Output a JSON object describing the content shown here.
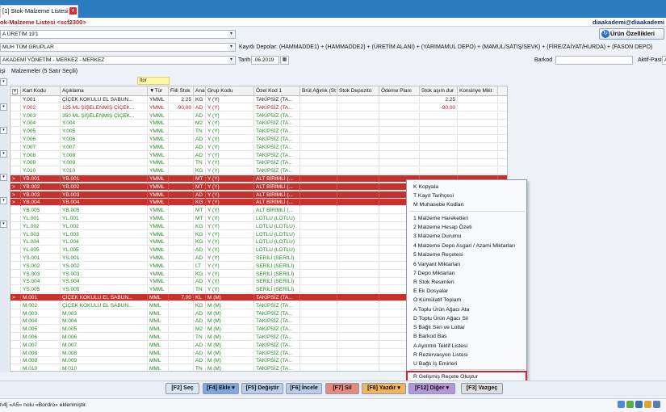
{
  "tab": {
    "label": "[1] Stok-Malzeme Listesi",
    "close": "x"
  },
  "window": {
    "title": "ok-Malzeme Listesi <scf2300>",
    "user": "diaakademi@diaakademi"
  },
  "filters": {
    "donem": "A ÜRETİM 19'1",
    "grup": "MUH TÜM GRUPLAR",
    "sube": "AKADEMİ YÖNETİM - MERKEZ - MERKEZ",
    "depolar_label": "Kayıtlı Depolar:",
    "depolar_value": "(HAMMADDE1) + (HAMMADDE2) + (ÜRETİM ALANI) + (YARIMAMUL DEPO) + (MAMUL/SATIŞ/SEVK) + (FİRE/ZAİYAT/HURDA) + (FASON DEPO)",
    "tarih_label": "Tarih",
    "tarih_value": ".06.2019",
    "barkod_label": "Barkod",
    "aktif_label": "Aktif-Pasif",
    "aktif_value": "A",
    "urun_btn": "Ürün Özellikleri"
  },
  "section": {
    "left_label": "işi",
    "title": "Malzemeler",
    "rowcount": "(5 Satır Seçili)",
    "filter_cell": "Itor"
  },
  "headers": {
    "kod": "Kart Kodu",
    "acik": "Açıklama",
    "tur": "▼Tür",
    "fiili": "Fiili Stok",
    "ana": "Ana",
    "grup": "Grup Kodu",
    "ozel": "Özel Kod 1",
    "brut": "Brüt Ağırlık (St",
    "depoz": "Stok Depozito",
    "odeme": "Ödeme Planı",
    "stok": "Stok aşım dur",
    "kons": "Konsinye Mikt"
  },
  "rows": [
    {
      "ind": "",
      "kod": "Y.001",
      "acik": "ÇİÇEK KOKULU EL SABUN...",
      "tur": "YMML",
      "fiili": "2,25",
      "ana": "KG",
      "grup": "Y (Y)",
      "ozel": "TAKİPSİZ (TA...",
      "stok": "2,25",
      "style": "black"
    },
    {
      "ind": "",
      "kod": "Y.002",
      "acik": "125 ML ŞİŞELENMİŞ ÇİÇEK...",
      "tur": "YMML",
      "fiili": "-90,00",
      "ana": "AD",
      "grup": "Y (Y)",
      "ozel": "TAKİPSİZ (TA...",
      "stok": "-90,00",
      "style": "red-txt"
    },
    {
      "ind": "",
      "kod": "Y.003",
      "acik": "350 ML ŞİŞELENMİŞ ÇİÇEK...",
      "tur": "YMML",
      "fiili": "",
      "ana": "AD",
      "grup": "Y (Y)",
      "ozel": "TAKİPSİZ (TA...",
      "stok": "",
      "style": "green"
    },
    {
      "ind": "",
      "kod": "Y.004",
      "acik": "Y.004",
      "tur": "YMML",
      "fiili": "",
      "ana": "M2",
      "grup": "Y (Y)",
      "ozel": "TAKİPSİZ (TA...",
      "stok": "",
      "style": "green"
    },
    {
      "ind": "",
      "kod": "Y.005",
      "acik": "Y.005",
      "tur": "YMML",
      "fiili": "",
      "ana": "TN",
      "grup": "Y (Y)",
      "ozel": "TAKİPSİZ (TA...",
      "stok": "",
      "style": "green"
    },
    {
      "ind": "",
      "kod": "Y.006",
      "acik": "Y.006",
      "tur": "YMML",
      "fiili": "",
      "ana": "AD",
      "grup": "Y (Y)",
      "ozel": "TAKİPSİZ (TA...",
      "stok": "",
      "style": "green"
    },
    {
      "ind": "",
      "kod": "Y.007",
      "acik": "Y.007",
      "tur": "YMML",
      "fiili": "",
      "ana": "AD",
      "grup": "Y (Y)",
      "ozel": "TAKİPSİZ (TA...",
      "stok": "",
      "style": "green"
    },
    {
      "ind": "",
      "kod": "Y.008",
      "acik": "Y.008",
      "tur": "YMML",
      "fiili": "",
      "ana": "AD",
      "grup": "Y (Y)",
      "ozel": "TAKİPSİZ (TA...",
      "stok": "",
      "style": "green"
    },
    {
      "ind": "",
      "kod": "Y.009",
      "acik": "Y.009",
      "tur": "YMML",
      "fiili": "",
      "ana": "TN",
      "grup": "Y (Y)",
      "ozel": "TAKİPSİZ (TA...",
      "stok": "",
      "style": "green"
    },
    {
      "ind": "",
      "kod": "Y.010",
      "acik": "Y.010",
      "tur": "YMML",
      "fiili": "",
      "ana": "KG",
      "grup": "Y (Y)",
      "ozel": "TAKİPSİZ (TA...",
      "stok": "",
      "style": "green"
    },
    {
      "ind": ">",
      "kod": "YB.001",
      "acik": "YB.001",
      "tur": "YMML",
      "fiili": "",
      "ana": "MT",
      "grup": "Y (Y)",
      "ozel": "ALT BİRİMLİ (...",
      "stok": "",
      "style": "hl"
    },
    {
      "ind": ">",
      "kod": "YB.002",
      "acik": "YB.002",
      "tur": "YMML",
      "fiili": "",
      "ana": "MT",
      "grup": "Y (Y)",
      "ozel": "ALT BİRİMLİ (...",
      "stok": "",
      "style": "hl"
    },
    {
      "ind": ">",
      "kod": "YB.003",
      "acik": "YB.003",
      "tur": "YMML",
      "fiili": "",
      "ana": "AD",
      "grup": "Y (Y)",
      "ozel": "ALT BİRİMLİ (...",
      "stok": "",
      "style": "hl"
    },
    {
      "ind": ">",
      "kod": "YB.004",
      "acik": "YB.004",
      "tur": "YMML",
      "fiili": "",
      "ana": "KG",
      "grup": "Y (Y)",
      "ozel": "ALT BİRİMLİ (...",
      "stok": "",
      "style": "hl"
    },
    {
      "ind": "",
      "kod": "YB.005",
      "acik": "YB.005",
      "tur": "YMML",
      "fiili": "",
      "ana": "MT",
      "grup": "Y (Y)",
      "ozel": "ALT BİRİMLİ (...",
      "stok": "",
      "style": "green"
    },
    {
      "ind": "",
      "kod": "YL.001",
      "acik": "YL.001",
      "tur": "YMML",
      "fiili": "",
      "ana": "MT",
      "grup": "Y (Y)",
      "ozel": "LOTLU (LOTLU)",
      "stok": "",
      "style": "green"
    },
    {
      "ind": "",
      "kod": "YL.002",
      "acik": "YL.002",
      "tur": "YMML",
      "fiili": "",
      "ana": "KG",
      "grup": "Y (Y)",
      "ozel": "LOTLU (LOTLU)",
      "stok": "",
      "style": "green"
    },
    {
      "ind": "",
      "kod": "YL.003",
      "acik": "YL.003",
      "tur": "YMML",
      "fiili": "",
      "ana": "KG",
      "grup": "Y (Y)",
      "ozel": "LOTLU (LOTLU)",
      "stok": "",
      "style": "green"
    },
    {
      "ind": "",
      "kod": "YL.004",
      "acik": "YL.004",
      "tur": "YMML",
      "fiili": "",
      "ana": "KG",
      "grup": "Y (Y)",
      "ozel": "LOTLU (LOTLU)",
      "stok": "",
      "style": "green"
    },
    {
      "ind": "",
      "kod": "YL.005",
      "acik": "YL.005",
      "tur": "YMML",
      "fiili": "",
      "ana": "AD",
      "grup": "Y (Y)",
      "ozel": "LOTLU (LOTLU)",
      "stok": "",
      "style": "green"
    },
    {
      "ind": "",
      "kod": "YS.001",
      "acik": "YS.001",
      "tur": "YMML",
      "fiili": "",
      "ana": "AD",
      "grup": "Y (Y)",
      "ozel": "SERİLİ (SERİLİ)",
      "stok": "",
      "style": "green"
    },
    {
      "ind": "",
      "kod": "YS.002",
      "acik": "YS.002",
      "tur": "YMML",
      "fiili": "",
      "ana": "LT",
      "grup": "Y (Y)",
      "ozel": "SERİLİ (SERİLİ)",
      "stok": "",
      "style": "green"
    },
    {
      "ind": "",
      "kod": "YS.003",
      "acik": "YS.003",
      "tur": "YMML",
      "fiili": "",
      "ana": "KG",
      "grup": "Y (Y)",
      "ozel": "SERİLİ (SERİLİ)",
      "stok": "",
      "style": "green"
    },
    {
      "ind": "",
      "kod": "YS.004",
      "acik": "YS.004",
      "tur": "YMML",
      "fiili": "",
      "ana": "AD",
      "grup": "Y (Y)",
      "ozel": "SERİLİ (SERİLİ)",
      "stok": "",
      "style": "green"
    },
    {
      "ind": "",
      "kod": "YS.005",
      "acik": "YS.005",
      "tur": "YMML",
      "fiili": "",
      "ana": "TN",
      "grup": "Y (Y)",
      "ozel": "SERİLİ (SERİLİ)",
      "stok": "",
      "style": "green"
    },
    {
      "ind": ">",
      "kod": "M.001",
      "acik": "ÇİÇEK KOKULU EL SABUN...",
      "tur": "MML",
      "fiili": "7,00",
      "ana": "KL",
      "grup": "M (M)",
      "ozel": "TAKİPSİZ (TA...",
      "stok": "",
      "style": "hl"
    },
    {
      "ind": "",
      "kod": "M.002",
      "acik": "ÇİÇEK KOKULU EL SABUN...",
      "tur": "MML",
      "fiili": "",
      "ana": "KG",
      "grup": "M (M)",
      "ozel": "TAKİPSİZ (TA...",
      "stok": "",
      "style": "green"
    },
    {
      "ind": "",
      "kod": "M.003",
      "acik": "M.003",
      "tur": "MML",
      "fiili": "",
      "ana": "AD",
      "grup": "M (M)",
      "ozel": "TAKİPSİZ (TA...",
      "stok": "",
      "style": "green"
    },
    {
      "ind": "",
      "kod": "M.004",
      "acik": "M.004",
      "tur": "MML",
      "fiili": "",
      "ana": "AD",
      "grup": "M (M)",
      "ozel": "TAKİPSİZ (TA...",
      "stok": "",
      "style": "green"
    },
    {
      "ind": "",
      "kod": "M.005",
      "acik": "M.005",
      "tur": "MML",
      "fiili": "",
      "ana": "M2",
      "grup": "M (M)",
      "ozel": "TAKİPSİZ (TA...",
      "stok": "",
      "style": "green"
    },
    {
      "ind": "",
      "kod": "M.006",
      "acik": "M.006",
      "tur": "MML",
      "fiili": "",
      "ana": "TN",
      "grup": "M (M)",
      "ozel": "TAKİPSİZ (TA...",
      "stok": "",
      "style": "green"
    },
    {
      "ind": "",
      "kod": "M.007",
      "acik": "M.007",
      "tur": "MML",
      "fiili": "",
      "ana": "AD",
      "grup": "M (M)",
      "ozel": "TAKİPSİZ (TA...",
      "stok": "",
      "style": "green"
    },
    {
      "ind": "",
      "kod": "M.008",
      "acik": "M.008",
      "tur": "MML",
      "fiili": "",
      "ana": "AD",
      "grup": "M (M)",
      "ozel": "TAKİPSİZ (TA...",
      "stok": "",
      "style": "green"
    },
    {
      "ind": "",
      "kod": "M.009",
      "acik": "M.009",
      "tur": "MML",
      "fiili": "",
      "ana": "AD",
      "grup": "M (M)",
      "ozel": "TAKİPSİZ (TA...",
      "stok": "",
      "style": "green"
    },
    {
      "ind": "",
      "kod": "M.010",
      "acik": "M.010",
      "tur": "MML",
      "fiili": "",
      "ana": "TN",
      "grup": "M (M)",
      "ozel": "TAKİPSİZ (TA...",
      "stok": "",
      "style": "green"
    }
  ],
  "menu": {
    "items": [
      "K Kopyala",
      "T Kayıt Tarihçesi",
      "M Muhasebe Kodları",
      "1 Malzeme Hareketleri",
      "2 Malzeme Hesap Özeti",
      "3 Malzeme Durumu",
      "4 Malzeme Depo Asgari / Azami Miktarları",
      "5 Malzeme Reçetesi",
      "6 Varyant Miktarları",
      "7 Depo Miktarları",
      "R Stok Resimleri",
      "E Ek Dosyalar",
      "O Kümülatif Toplam",
      "A Toplu Ürün Ağacı Ata",
      "D Toplu Ürün Ağacı Sil",
      "S Bağlı Seri ve Lotlar",
      "B Barkod Bas",
      "A Ayrıntılı Teklif Listesi",
      "R Rezervasyon Listesi",
      "U Bağlı İş Emirleri",
      "R Gelişmiş Reçete Oluştur"
    ]
  },
  "buttons": {
    "f2": "[F2] Seç",
    "f4": "[F4] Ekle ▾",
    "f5": "[F5] Değiştir",
    "f6": "[F6] İncele",
    "f7": "[F7] Sil",
    "f8": "[F8] Yazdır ▾",
    "f12": "[F12] Diğer ▾",
    "f3": "[F3] Vazgeç"
  },
  "status": {
    "text": "n4] «A5» nolu «Bordro» eklenmiştir."
  },
  "colors": {
    "accent": "#2a7bbf",
    "highlight_row": "#c9302c",
    "menu_outline": "#d7202b",
    "green_text": "#1e8b1e"
  }
}
